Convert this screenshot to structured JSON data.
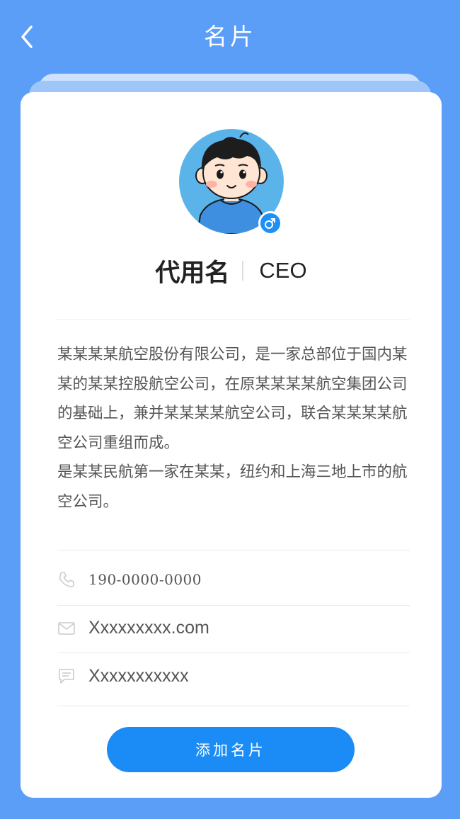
{
  "header": {
    "title": "名片",
    "back_icon": "chevron-left-icon"
  },
  "profile": {
    "name": "代用名",
    "title": "CEO",
    "gender_icon": "male-icon"
  },
  "description": [
    "某某某某航空股份有限公司，是一家总部位于国内某某的某某控股航空公司，在原某某某某航空集团公司的基础上，兼并某某某某航空公司，联合某某某某航空公司重组而成。",
    "是某某民航第一家在某某，纽约和上海三地上市的航空公司。"
  ],
  "contacts": {
    "phone": "190-0000-0000",
    "email": "Xxxxxxxxx.com",
    "message": "Xxxxxxxxxxx"
  },
  "actions": {
    "add_card_label": "添加名片"
  },
  "colors": {
    "background": "#5b9ef8",
    "accent": "#1b8cf6",
    "card": "#ffffff"
  }
}
